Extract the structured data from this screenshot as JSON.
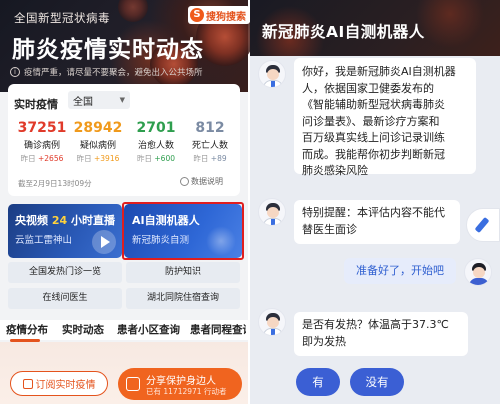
{
  "left": {
    "header": {
      "subtitle": "全国新型冠状病毒",
      "title": "肺炎疫情实时动态",
      "notice": "疫情严重，请尽量不要聚会，避免出入公共场所",
      "brand": "搜狗搜索",
      "brand_icon": "sogou-logo-icon"
    },
    "stats": {
      "title": "实时疫情",
      "region": "全国",
      "items": [
        {
          "value": "37251",
          "label": "确诊病例",
          "delta_label": "昨日",
          "delta": "+2656",
          "color": "#e03a2a"
        },
        {
          "value": "28942",
          "label": "疑似病例",
          "delta_label": "昨日",
          "delta": "+3916",
          "color": "#f09a1c"
        },
        {
          "value": "2701",
          "label": "治愈人数",
          "delta_label": "昨日",
          "delta": "+600",
          "color": "#2e9e4e"
        },
        {
          "value": "812",
          "label": "死亡人数",
          "delta_label": "昨日",
          "delta": "+89",
          "color": "#7b8ba3"
        }
      ],
      "updated": "截至2月9日13时09分",
      "explain": "数据说明"
    },
    "tv_card": {
      "title_pre": "央视频",
      "title_hl": "24",
      "title_post": "小时直播",
      "subtitle": "云监工雷神山"
    },
    "ai_card": {
      "title": "AI自测机器人",
      "subtitle": "新冠肺炎自测"
    },
    "quick_links": [
      "全国发热门诊一览",
      "防护知识",
      "在线问医生",
      "湖北同院住宿查询"
    ],
    "tabs": [
      "疫情分布",
      "实时动态",
      "患者小区查询",
      "患者同程查询"
    ],
    "subscribe": "订阅实时疫情",
    "share": {
      "title": "分享保护身边人",
      "subtitle": "已有 11712971 行动者"
    },
    "accent": "#e4531d"
  },
  "right": {
    "title": "新冠肺炎AI自测机器人",
    "messages": [
      {
        "from": "bot",
        "lines": [
          "你好，我是新冠肺炎AI自测机器",
          "人，依据国家卫健委发布的",
          "《智能辅助新型冠状病毒肺炎",
          "问诊量表》、最新诊疗方案和",
          "百万级真实线上问诊记录训练",
          "而成。我能帮你初步判断新冠",
          "肺炎感染风险"
        ]
      },
      {
        "from": "bot",
        "lines": [
          "特别提醒：本评估内容不能代",
          "替医生面诊"
        ]
      },
      {
        "from": "user",
        "lines": [
          "准备好了，开始吧"
        ]
      },
      {
        "from": "bot",
        "lines": [
          "是否有发热？体温高于37.3℃",
          "即为发热"
        ]
      }
    ],
    "answers": [
      "有",
      "没有"
    ],
    "button_color": "#3b5fd4"
  }
}
